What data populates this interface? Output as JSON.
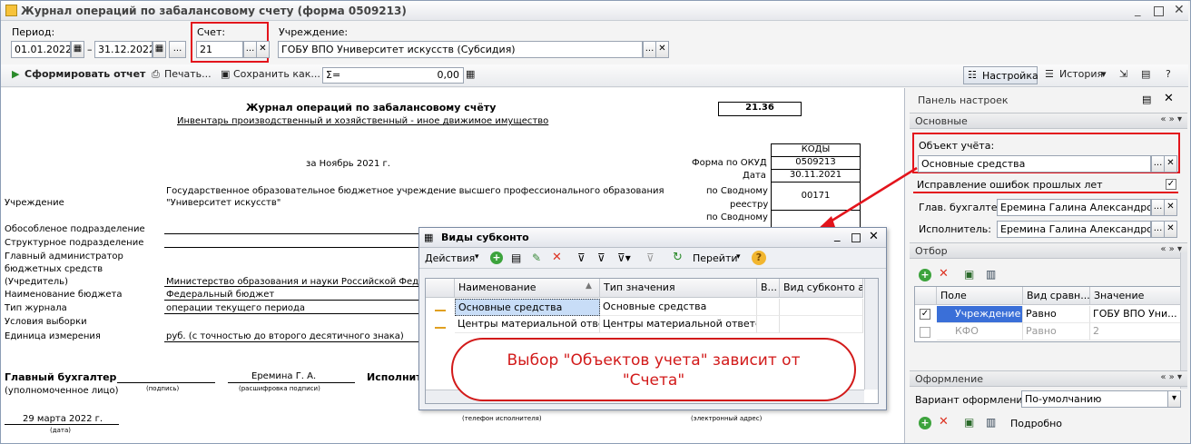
{
  "window": {
    "title": "Журнал операций по забалансовому счету (форма 0509213)"
  },
  "filters": {
    "period_label": "Период:",
    "date_from": "01.01.2022",
    "date_sep": "–",
    "date_to": "31.12.2022",
    "ellipsis": "...",
    "account_label": "Счет:",
    "account_value": "21",
    "institution_label": "Учреждение:",
    "institution_value": "ГОБУ ВПО Университет искусств (Субсидия)"
  },
  "toolbar": {
    "generate": "Сформировать отчет",
    "print": "Печать...",
    "save": "Сохранить как...",
    "sum_symbol": "Σ=",
    "sum_value": "0,00",
    "settings": "Настройка",
    "history": "История"
  },
  "report": {
    "title": "Журнал операций по забалансовому счёту",
    "subtitle": "Инвентарь производственный и хозяйственный - иное движимое имущество",
    "code_box": "21.36",
    "period": "за Ноябрь 2021 г.",
    "codes_header": "КОДЫ",
    "okud_label": "Форма по ОКУД",
    "okud_value": "0509213",
    "date_label": "Дата",
    "date_value": "30.11.2021",
    "svod_label_1": "по Сводному",
    "svod_label_2": "реестру",
    "svod_value": "00171",
    "svod2_label": "по Сводному",
    "institution_label": "Учреждение",
    "institution_1": "Государственное образовательное бюджетное учреждение высшего профессионального образования",
    "institution_2": "\"Университет искусств\"",
    "rows": [
      {
        "label": "Обособленое подразделение",
        "value": ""
      },
      {
        "label": "Структурное подразделение",
        "value": ""
      },
      {
        "label": "Главный администратор",
        "value": ""
      },
      {
        "label": "бюджетных средств",
        "value": ""
      },
      {
        "label": "(Учредитель)",
        "value": "Министерство образования и науки Российской Феде"
      },
      {
        "label": "Наименование бюджета",
        "value": "Федеральный бюджет"
      },
      {
        "label": "Тип журнала",
        "value": "операции текущего периода"
      },
      {
        "label": "Условия выборки",
        "value": ""
      },
      {
        "label": "Единица измерения",
        "value": "руб. (с точностью до второго десятичного знака)"
      }
    ],
    "chief_label": "Главный бухгалтер",
    "chief_sub": "(уполномоченное лицо)",
    "sign_caption": "(подпись)",
    "chief_name": "Еремина Г. А.",
    "decode_caption": "(расшифровка подписи)",
    "executor_label": "Исполнител",
    "sign_date": "29 марта 2022 г.",
    "date_caption": "(дата)",
    "phone_caption": "(телефон исполнителя)",
    "email_caption": "(электронный адрес)"
  },
  "settings_panel": {
    "title": "Панель настроек",
    "basic_section": "Основные",
    "object_label": "Объект учёта:",
    "object_value": "Основные средства",
    "fix_errors_label": "Исправление ошибок прошлых лет",
    "chief_label": "Глав. бухгалтер:",
    "chief_value": "Еремина Галина Александровна",
    "executor_label": "Исполнитель:",
    "executor_value": "Еремина Галина Александровна",
    "filter_section": "Отбор",
    "filter_columns": [
      "Поле",
      "Вид сравн...",
      "Значение"
    ],
    "filter_rows": [
      {
        "checked": true,
        "field": "Учреждение",
        "cmp": "Равно",
        "value": "ГОБУ ВПО Уни..."
      },
      {
        "checked": false,
        "field": "КФО",
        "cmp": "Равно",
        "value": "2"
      }
    ],
    "design_section": "Оформление",
    "variant_label": "Вариант оформления:",
    "variant_value": "По-умолчанию",
    "more_label": "Подробно"
  },
  "dialog": {
    "title": "Виды субконто",
    "actions_label": "Действия",
    "goto_label": "Перейти",
    "columns": [
      "Наименование",
      "Тип значения",
      "В...",
      "Вид субконто ан..."
    ],
    "rows": [
      {
        "name": "Основные средства",
        "type": "Основные средства"
      },
      {
        "name": "Центры материальной ответс...",
        "type": "Центры материальной ответс..."
      }
    ]
  },
  "callout": {
    "line1": "Выбор \"Объектов учета\" зависит от",
    "line2": "\"Счета\""
  },
  "colors": {
    "accent_red": "#e3141c",
    "selection_blue": "#3a6fd8"
  }
}
